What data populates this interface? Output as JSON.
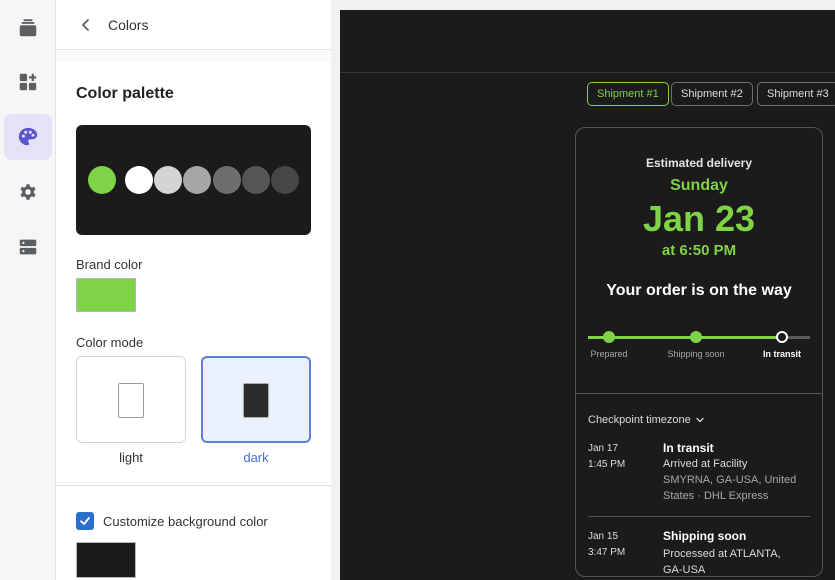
{
  "rail": {
    "icons": [
      "layers-icon",
      "dashboard-add-icon",
      "palette-icon",
      "gear-icon",
      "server-icon"
    ],
    "active_index": 2
  },
  "panel": {
    "title": "Colors",
    "palette_heading": "Color palette",
    "palette_colors": [
      "#7ed347",
      "#ffffff",
      "#d4d4d4",
      "#a6a6a6",
      "#6e6e6e",
      "#555555",
      "#464646"
    ],
    "brand_color_label": "Brand color",
    "brand_color": "#7ed347",
    "color_mode_label": "Color mode",
    "modes": [
      {
        "label": "light",
        "selected": false
      },
      {
        "label": "dark",
        "selected": true
      }
    ],
    "customize_bg_label": "Customize background color",
    "customize_bg_checked": true,
    "background_color": "#1c1a1a"
  },
  "preview": {
    "shipments": [
      "Shipment #1",
      "Shipment #2",
      "Shipment #3"
    ],
    "active_shipment": 0,
    "estimated_label": "Estimated delivery",
    "day": "Sunday",
    "date": "Jan 23",
    "time": "at 6:50 PM",
    "status_heading": "Your order is on the way",
    "progress_steps": [
      "Prepared",
      "Shipping soon",
      "In transit"
    ],
    "current_step": 2,
    "timezone_label": "Checkpoint timezone",
    "checkpoints": [
      {
        "date": "Jan 17",
        "time": "1:45 PM",
        "title": "In transit",
        "detail": "Arrived at Facility",
        "location": "SMYRNA, GA-USA, United States · DHL Express"
      },
      {
        "date": "Jan 15",
        "time": "3:47 PM",
        "title": "Shipping soon",
        "detail": "Processed at ATLANTA, GA-USA"
      }
    ]
  }
}
